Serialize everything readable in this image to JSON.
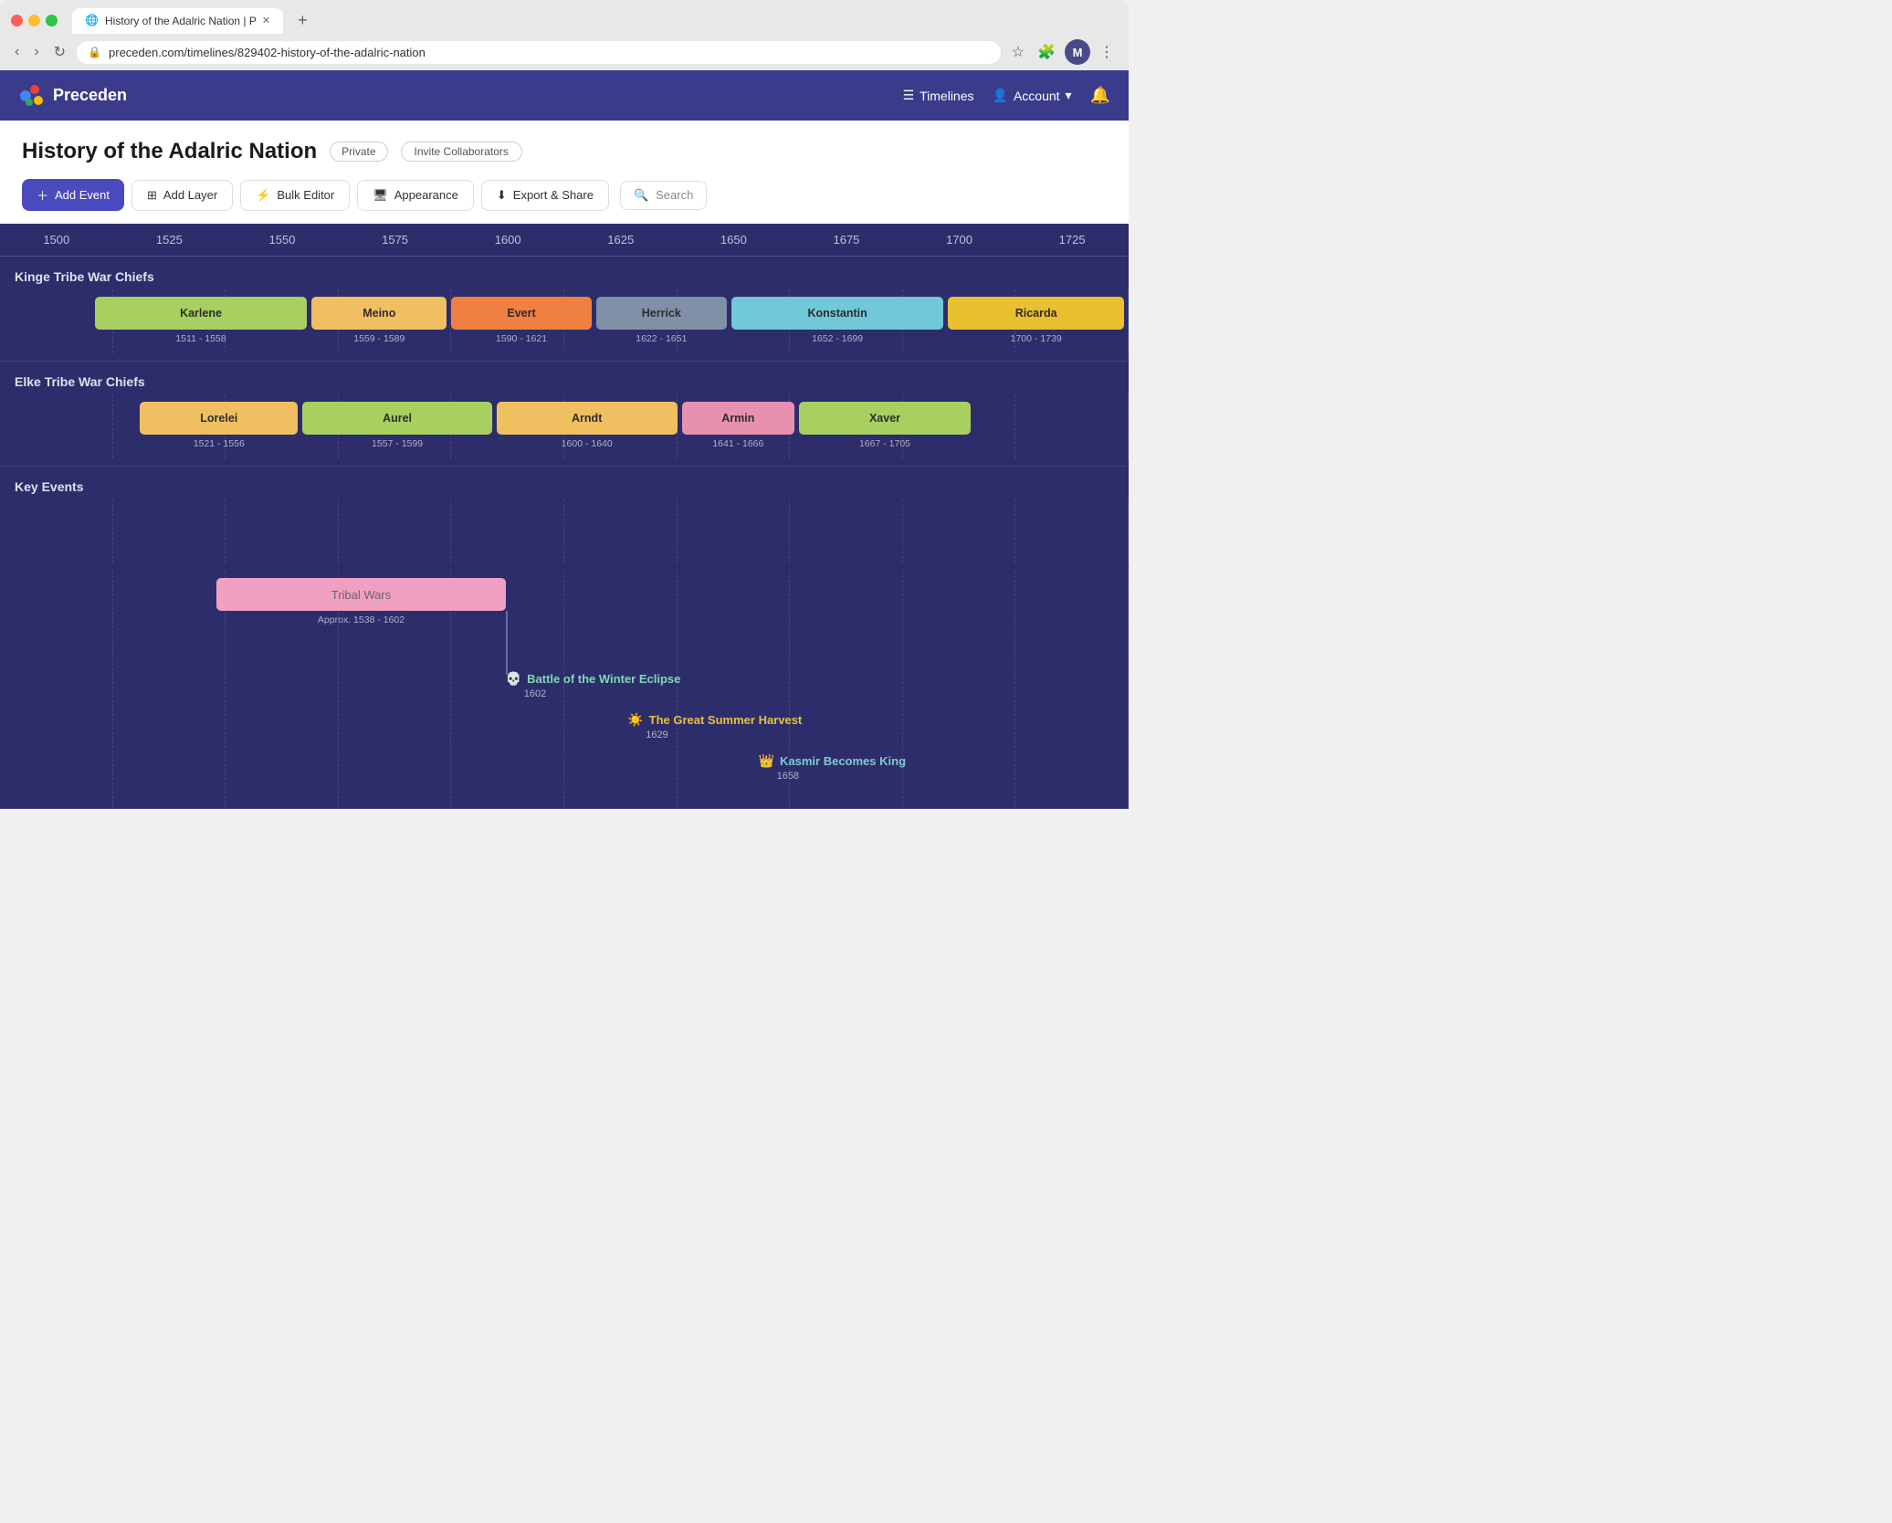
{
  "browser": {
    "tab_title": "History of the Adalric Nation | P",
    "url": "preceden.com/timelines/829402-history-of-the-adalric-nation",
    "profile_letter": "M",
    "new_tab_label": "+"
  },
  "header": {
    "logo_text": "Preceden",
    "nav": {
      "timelines_label": "Timelines",
      "account_label": "Account"
    }
  },
  "page": {
    "title": "History of the Adalric Nation",
    "private_badge": "Private",
    "invite_badge": "Invite Collaborators"
  },
  "toolbar": {
    "add_event_label": "Add Event",
    "add_layer_label": "Add Layer",
    "bulk_editor_label": "Bulk Editor",
    "appearance_label": "Appearance",
    "export_share_label": "Export & Share",
    "search_placeholder": "Search"
  },
  "timeline": {
    "time_markers": [
      "1500",
      "1525",
      "1550",
      "1575",
      "1600",
      "1625",
      "1650",
      "1675",
      "1700",
      "1725"
    ],
    "sections": [
      {
        "id": "kinge",
        "label": "Kinge Tribe War Chiefs",
        "events": [
          {
            "name": "Karlene",
            "start": 1511,
            "end": 1558,
            "color": "#a8d060",
            "date_label": "1511 - 1558"
          },
          {
            "name": "Meino",
            "start": 1559,
            "end": 1589,
            "color": "#f0c060",
            "date_label": "1559 - 1589"
          },
          {
            "name": "Evert",
            "start": 1590,
            "end": 1621,
            "color": "#f08040",
            "date_label": "1590 - 1621"
          },
          {
            "name": "Herrick",
            "start": 1622,
            "end": 1651,
            "color": "#8090a8",
            "date_label": "1622 - 1651"
          },
          {
            "name": "Konstantin",
            "start": 1652,
            "end": 1699,
            "color": "#70c8d8",
            "date_label": "1652 - 1699"
          },
          {
            "name": "Ricarda",
            "start": 1700,
            "end": 1739,
            "color": "#e8c030",
            "date_label": "1700 - 1739"
          }
        ]
      },
      {
        "id": "elke",
        "label": "Elke Tribe War Chiefs",
        "events": [
          {
            "name": "Lorelei",
            "start": 1521,
            "end": 1556,
            "color": "#f0c060",
            "date_label": "1521 - 1556"
          },
          {
            "name": "Aurel",
            "start": 1557,
            "end": 1599,
            "color": "#a8d060",
            "date_label": "1557 - 1599"
          },
          {
            "name": "Arndt",
            "start": 1600,
            "end": 1640,
            "color": "#f0c060",
            "date_label": "1600 - 1640"
          },
          {
            "name": "Armin",
            "start": 1641,
            "end": 1666,
            "color": "#e890b0",
            "date_label": "1641 - 1666"
          },
          {
            "name": "Xaver",
            "start": 1667,
            "end": 1705,
            "color": "#a8d060",
            "date_label": "1667 - 1705"
          }
        ]
      },
      {
        "id": "key",
        "label": "Key Events",
        "range_events": [
          {
            "name": "Tribal Wars",
            "start": 1538,
            "end": 1602,
            "color": "#f0a0c0",
            "date_label": "Approx. 1538 - 1602"
          }
        ],
        "point_events": [
          {
            "name": "Battle of the Winter Eclipse",
            "year": 1602,
            "color": "#80d8b0",
            "icon": "💀"
          },
          {
            "name": "The Great Summer Harvest",
            "year": 1629,
            "color": "#e8c040",
            "icon": "☀️"
          },
          {
            "name": "Kasmir Becomes King",
            "year": 1658,
            "color": "#80c8d0",
            "icon": "👑"
          }
        ]
      }
    ]
  }
}
